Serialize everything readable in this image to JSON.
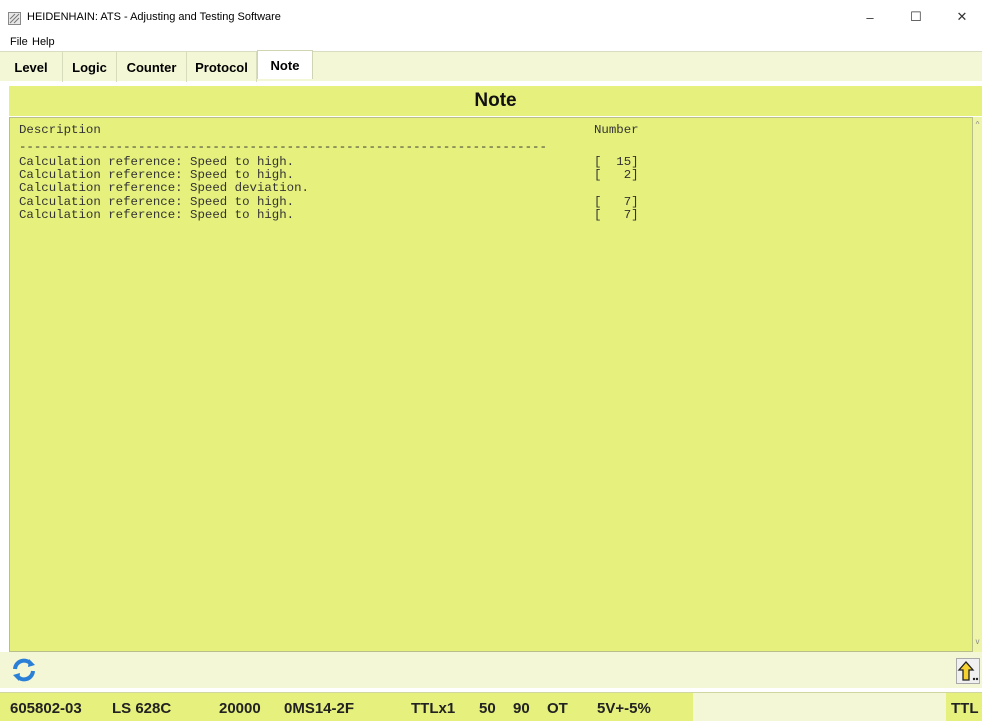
{
  "window": {
    "title": "HEIDENHAIN: ATS - Adjusting and Testing Software",
    "minimize_glyph": "–",
    "maximize_glyph": "☐",
    "close_glyph": "✕"
  },
  "menu": {
    "file": "File",
    "help": "Help"
  },
  "tabs": [
    {
      "label": "Level"
    },
    {
      "label": "Logic"
    },
    {
      "label": "Counter"
    },
    {
      "label": "Protocol"
    },
    {
      "label": "Note"
    }
  ],
  "active_tab": "Note",
  "page": {
    "title": "Note"
  },
  "table": {
    "col_description": "Description",
    "col_number": "Number",
    "separator": "-----------------------------------------------------------------------",
    "rows": [
      {
        "description": "Calculation reference: Speed to high.",
        "number": "[  15]"
      },
      {
        "description": "Calculation reference: Speed to high.",
        "number": "[   2]"
      },
      {
        "description": "Calculation reference: Speed deviation.",
        "number": ""
      },
      {
        "description": "Calculation reference: Speed to high.",
        "number": "[   7]"
      },
      {
        "description": "Calculation reference: Speed to high.",
        "number": "[   7]"
      }
    ]
  },
  "scrollbar": {
    "up_glyph": "^",
    "down_glyph": "v"
  },
  "icons": {
    "app": "app-icon",
    "refresh": "refresh-icon",
    "up_arrow": "up-arrow-icon"
  },
  "status": {
    "id": "605802-03",
    "model": "LS 628C",
    "count": "20000",
    "code": "0MS14-2F",
    "interface": "TTLx1",
    "val1": "50",
    "val2": "90",
    "val3": "OT",
    "voltage": "5V+-5%",
    "right": "TTL"
  },
  "colors": {
    "panel": "#e6f07d",
    "panel_light": "#f4f7d6",
    "refresh_blue": "#2a7fd6"
  }
}
